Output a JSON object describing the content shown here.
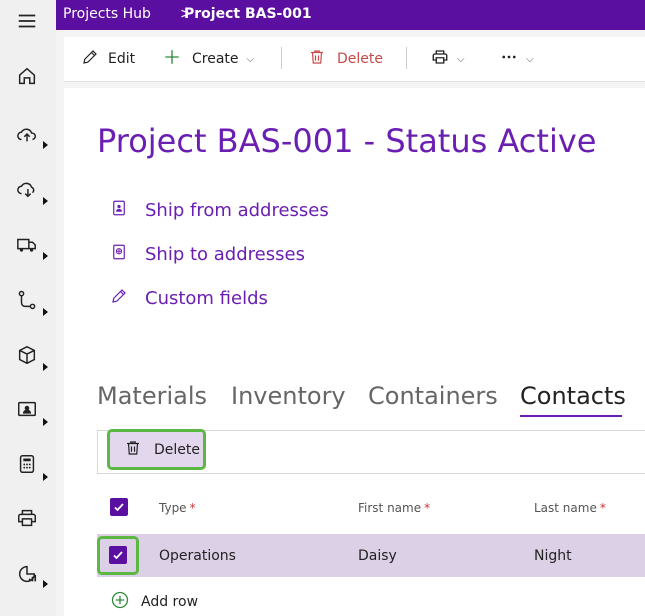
{
  "breadcrumb": {
    "hub": "Projects Hub",
    "separator": ">",
    "project": "Project BAS-001"
  },
  "toolbar": {
    "edit": "Edit",
    "create": "Create",
    "delete": "Delete",
    "chevron": "⌵"
  },
  "page": {
    "title": "Project BAS-001 - Status Active"
  },
  "links": [
    {
      "label": "Ship from addresses",
      "icon": "address-book-icon"
    },
    {
      "label": "Ship to addresses",
      "icon": "globe-book-icon"
    },
    {
      "label": "Custom fields",
      "icon": "pencil-icon"
    }
  ],
  "tabs": [
    {
      "label": "Materials"
    },
    {
      "label": "Inventory"
    },
    {
      "label": "Containers"
    },
    {
      "label": "Contacts",
      "active": true
    }
  ],
  "contacts": {
    "delete_label": "Delete",
    "columns": [
      {
        "label": "Type",
        "required_mark": "*"
      },
      {
        "label": "First name",
        "required_mark": "*"
      },
      {
        "label": "Last name",
        "required_mark": "*"
      }
    ],
    "rows": [
      {
        "type": "Operations",
        "first_name": "Daisy",
        "last_name": "Night",
        "selected": true
      }
    ],
    "add_row_label": "Add row"
  },
  "colors": {
    "accent": "#5b0fa0",
    "link": "#6a1fb2",
    "highlight": "#5bb843",
    "selected_row": "#dcd0e6",
    "danger": "#d13438"
  }
}
